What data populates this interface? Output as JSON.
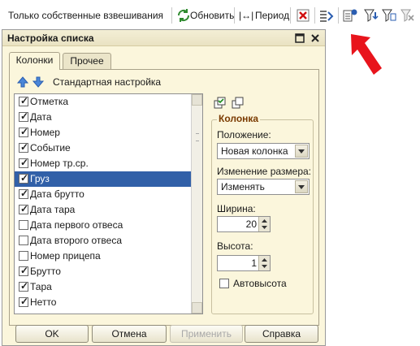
{
  "toolbar": {
    "only_own_label": "Только собственные взвешивания",
    "refresh_label": "Обновить",
    "period_label": "Период"
  },
  "dialog": {
    "title": "Настройка списка",
    "tabs": [
      {
        "label": "Колонки",
        "active": true
      },
      {
        "label": "Прочее",
        "active": false
      }
    ],
    "standard_settings_label": "Стандартная настройка",
    "columns": [
      {
        "label": "Отметка",
        "checked": true,
        "selected": false
      },
      {
        "label": "Дата",
        "checked": true,
        "selected": false
      },
      {
        "label": "Номер",
        "checked": true,
        "selected": false
      },
      {
        "label": "Событие",
        "checked": true,
        "selected": false
      },
      {
        "label": "Номер тр.ср.",
        "checked": true,
        "selected": false
      },
      {
        "label": "Груз",
        "checked": true,
        "selected": true
      },
      {
        "label": "Дата брутто",
        "checked": true,
        "selected": false
      },
      {
        "label": "Дата тара",
        "checked": true,
        "selected": false
      },
      {
        "label": "Дата первого отвеса",
        "checked": false,
        "selected": false
      },
      {
        "label": "Дата второго отвеса",
        "checked": false,
        "selected": false
      },
      {
        "label": "Номер прицепа",
        "checked": false,
        "selected": false
      },
      {
        "label": "Брутто",
        "checked": true,
        "selected": false
      },
      {
        "label": "Тара",
        "checked": true,
        "selected": false
      },
      {
        "label": "Нетто",
        "checked": true,
        "selected": false
      }
    ],
    "column_group": {
      "title": "Колонка",
      "position_label": "Положение:",
      "position_value": "Новая колонка",
      "resize_label": "Изменение размера:",
      "resize_value": "Изменять",
      "width_label": "Ширина:",
      "width_value": "20",
      "height_label": "Высота:",
      "height_value": "1",
      "autoheight_label": "Автовысота",
      "autoheight_checked": false
    },
    "buttons": {
      "ok": "OK",
      "cancel": "Отмена",
      "apply": "Применить",
      "help": "Справка"
    }
  },
  "colors": {
    "dialog_bg": "#fbf6dc",
    "selection": "#3160a8",
    "arrow": "#e8141c",
    "group_title": "#7a3a00"
  }
}
